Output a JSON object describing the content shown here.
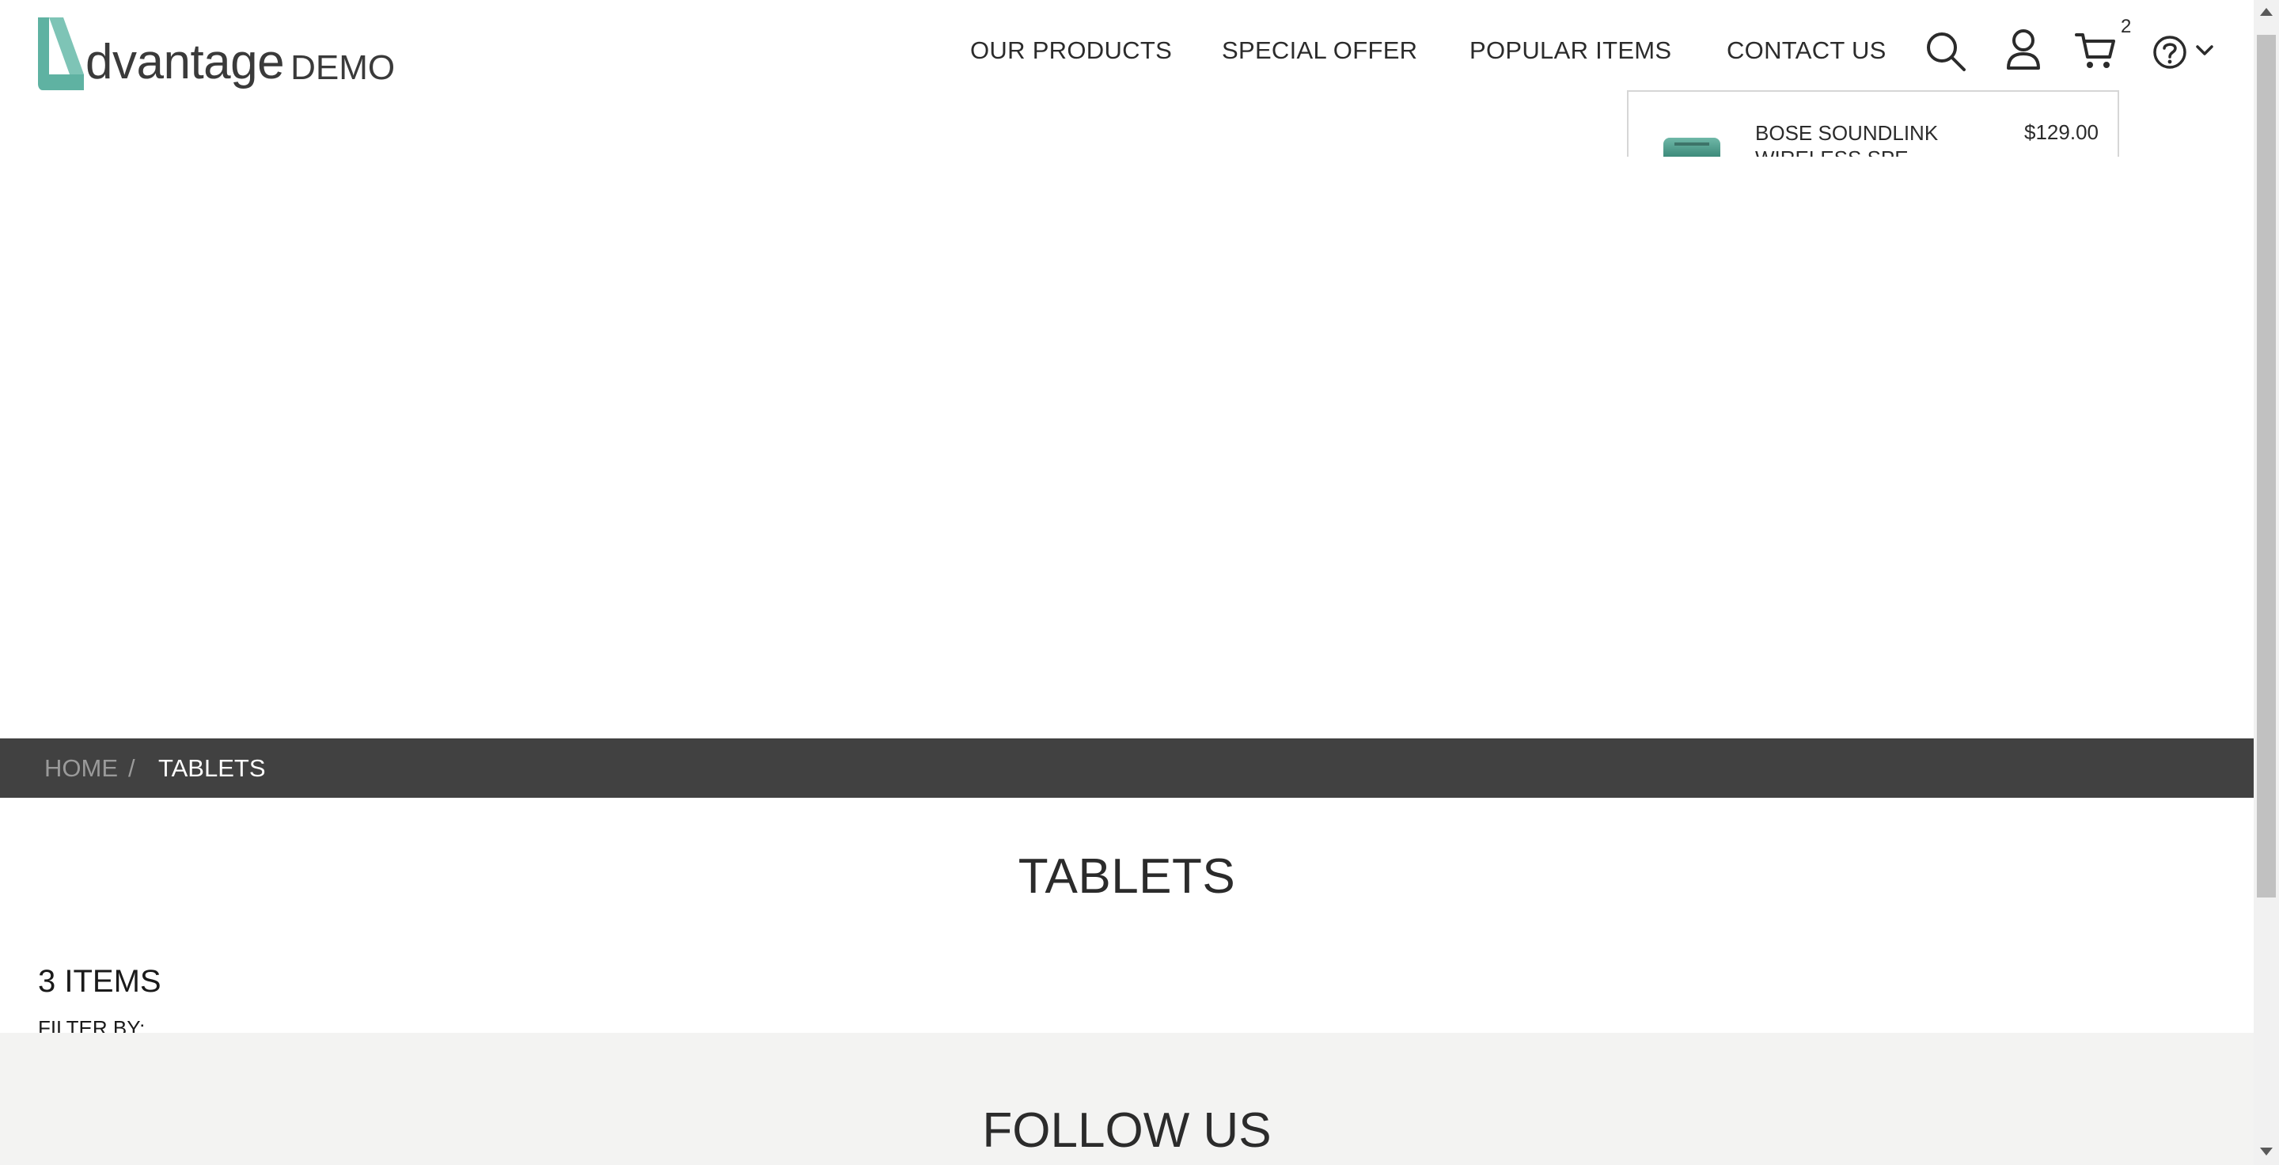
{
  "brand": {
    "name": "dvantage",
    "suffix": "DEMO",
    "accent_color": "#5fb2a2"
  },
  "nav": {
    "items": [
      {
        "label": "OUR PRODUCTS"
      },
      {
        "label": "SPECIAL OFFER"
      },
      {
        "label": "POPULAR ITEMS"
      },
      {
        "label": "CONTACT US"
      }
    ]
  },
  "header_icons": {
    "search": "search-icon",
    "user": "user-icon",
    "cart": "cart-icon",
    "help": "help-icon",
    "cart_count": "2"
  },
  "cart_dropdown": {
    "item_name": "BOSE SOUNDLINK WIRELESS SPE...",
    "item_price": "$129.00"
  },
  "breadcrumb": {
    "home": "HOME",
    "separator": "/",
    "current": "TABLETS"
  },
  "category": {
    "title": "TABLETS",
    "items_count": "3 ITEMS",
    "filter_label": "FILTER BY:"
  },
  "footer": {
    "follow_title": "FOLLOW US"
  }
}
